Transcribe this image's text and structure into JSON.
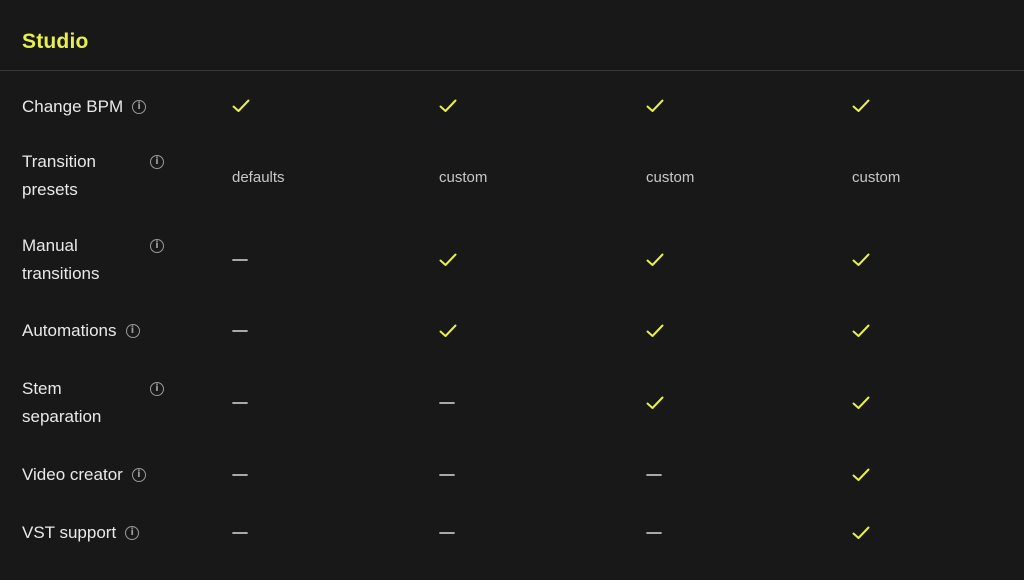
{
  "section": {
    "title": "Studio"
  },
  "colors": {
    "accent": "#e8f04a",
    "background": "#181818",
    "dash": "#bdbdbd"
  },
  "rows": [
    {
      "feature": "Change BPM",
      "info_icon": "info-icon",
      "cells": [
        "check",
        "check",
        "check",
        "check"
      ]
    },
    {
      "feature": "Transition presets",
      "info_icon": "info-icon",
      "cells": [
        "defaults",
        "custom",
        "custom",
        "custom"
      ]
    },
    {
      "feature": "Manual transitions",
      "info_icon": "info-icon",
      "cells": [
        "dash",
        "check",
        "check",
        "check"
      ]
    },
    {
      "feature": "Automations",
      "info_icon": "info-icon",
      "cells": [
        "dash",
        "check",
        "check",
        "check"
      ]
    },
    {
      "feature": "Stem separation",
      "info_icon": "info-icon",
      "cells": [
        "dash",
        "dash",
        "check",
        "check"
      ]
    },
    {
      "feature": "Video creator",
      "info_icon": "info-icon",
      "cells": [
        "dash",
        "dash",
        "dash",
        "check"
      ]
    },
    {
      "feature": "VST support",
      "info_icon": "info-icon",
      "cells": [
        "dash",
        "dash",
        "dash",
        "check"
      ]
    }
  ]
}
